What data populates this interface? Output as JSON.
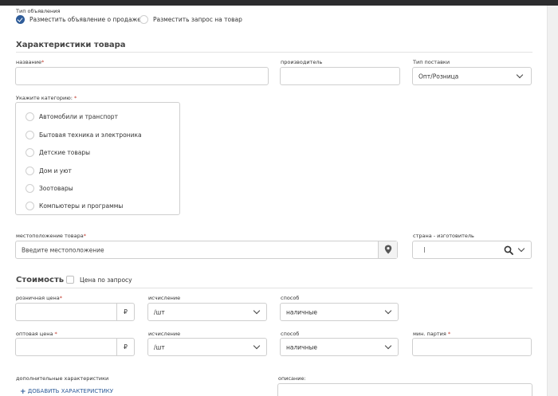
{
  "ad_type": {
    "label": "Тип объявления",
    "options": [
      "Разместить объявление о продаже",
      "Разместить запрос на товар"
    ]
  },
  "characteristics": {
    "title": "Характеристики товара",
    "name_label": "название",
    "manufacturer_label": "производитель",
    "delivery_label": "Тип поставки",
    "delivery_value": "Опт/Розница",
    "category_label": "Укажите категорию:",
    "categories": [
      "Автомобили и транспорт",
      "Бытовая техника и электроника",
      "Детские товары",
      "Дом и уют",
      "Зоотовары",
      "Компьютеры и программы"
    ],
    "location_label": "местоположение товара",
    "location_placeholder": "Введите местоположение",
    "country_label": "страна - изготовитель"
  },
  "cost": {
    "title": "Стоимость",
    "on_request_label": "Цена по запросу",
    "retail_label": "розничная цена",
    "wholesale_label": "оптовая цена",
    "currency": "₽",
    "unit_label": "исчисление",
    "unit_value": "/шт",
    "method_label": "способ",
    "method_value": "наличные",
    "min_batch_label": "мин. партия"
  },
  "extra": {
    "label": "дополнительные характеристики",
    "add_link": "ДОБАВИТЬ ХАРАКТЕРИСТИКУ",
    "description_label": "описание:"
  }
}
